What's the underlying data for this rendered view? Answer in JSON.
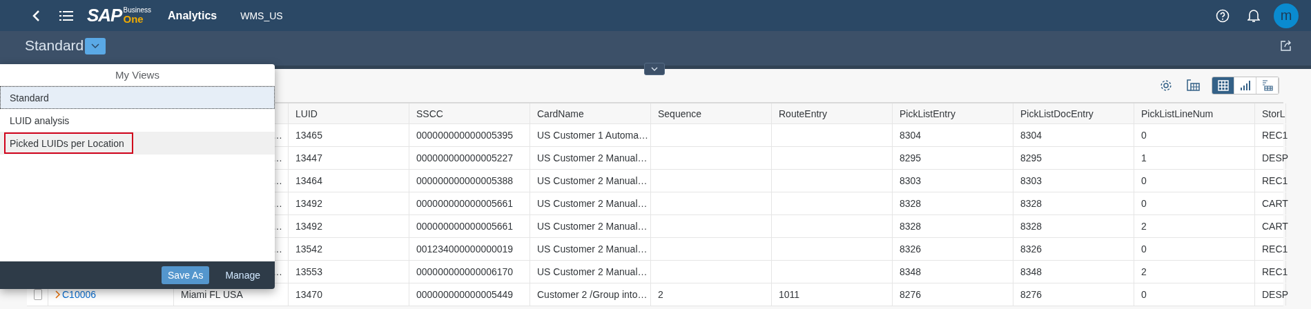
{
  "shell_bar": {
    "logo": {
      "brand": "SAP",
      "line1": "Business",
      "line2": "One"
    },
    "app_title": "Analytics",
    "company": "WMS_US",
    "avatar": "m"
  },
  "view_bar": {
    "title": "Standard"
  },
  "views_popover": {
    "title": "My Views",
    "items": [
      {
        "label": "Standard",
        "selected": true,
        "hovered": false,
        "highlighted": false
      },
      {
        "label": "LUID analysis",
        "selected": false,
        "hovered": false,
        "highlighted": false
      },
      {
        "label": "Picked LUIDs per Location",
        "selected": false,
        "hovered": true,
        "highlighted": true
      }
    ],
    "buttons": [
      {
        "label": "Save As",
        "kind": "primary"
      },
      {
        "label": "Manage",
        "kind": "link"
      }
    ]
  },
  "toolbar": {
    "view_modes": [
      {
        "kind": "table",
        "selected": true
      },
      {
        "kind": "chart",
        "selected": false
      },
      {
        "kind": "pivot",
        "selected": false
      }
    ]
  },
  "table": {
    "columns": [
      "LUID",
      "SSCC",
      "CardName",
      "Sequence",
      "RouteEntry",
      "PickListEntry",
      "PickListDocEntry",
      "PickListLineNum",
      "StorL"
    ],
    "rows": [
      {
        "address": "…",
        "cells": [
          "13465",
          "000000000000005395",
          "US Customer 1 Automa…",
          null,
          null,
          "8304",
          "8304",
          "0",
          "REC1"
        ]
      },
      {
        "address": "…",
        "cells": [
          "13447",
          "000000000000005227",
          "US Customer 2 Manual…",
          null,
          null,
          "8295",
          "8295",
          "1",
          "DESP"
        ]
      },
      {
        "address": "…",
        "cells": [
          "13464",
          "000000000000005388",
          "US Customer 2 Manual…",
          null,
          null,
          "8303",
          "8303",
          "0",
          "REC1"
        ]
      },
      {
        "address": "…",
        "cells": [
          "13492",
          "000000000000005661",
          "US Customer 2 Manual…",
          null,
          null,
          "8328",
          "8328",
          "0",
          "CART"
        ]
      },
      {
        "address": "…",
        "cells": [
          "13492",
          "000000000000005661",
          "US Customer 2 Manual…",
          null,
          null,
          "8328",
          "8328",
          "2",
          "CART"
        ]
      },
      {
        "address": "…",
        "cells": [
          "13542",
          "001234000000000019",
          "US Customer 2 Manual…",
          null,
          null,
          "8326",
          "8326",
          "0",
          "REC1"
        ]
      },
      {
        "address": "…",
        "cells": [
          "13553",
          "000000000000006170",
          "US Customer 2 Manual…",
          null,
          null,
          "8348",
          "8348",
          "2",
          "REC1"
        ]
      },
      {
        "checked": false,
        "code": "C10006",
        "address": "Miami FL USA",
        "cells": [
          "13470",
          "000000000000005449",
          "Customer 2 /Group into…",
          "2",
          "1011",
          "8276",
          "8276",
          "0",
          "DESP"
        ]
      }
    ]
  }
}
